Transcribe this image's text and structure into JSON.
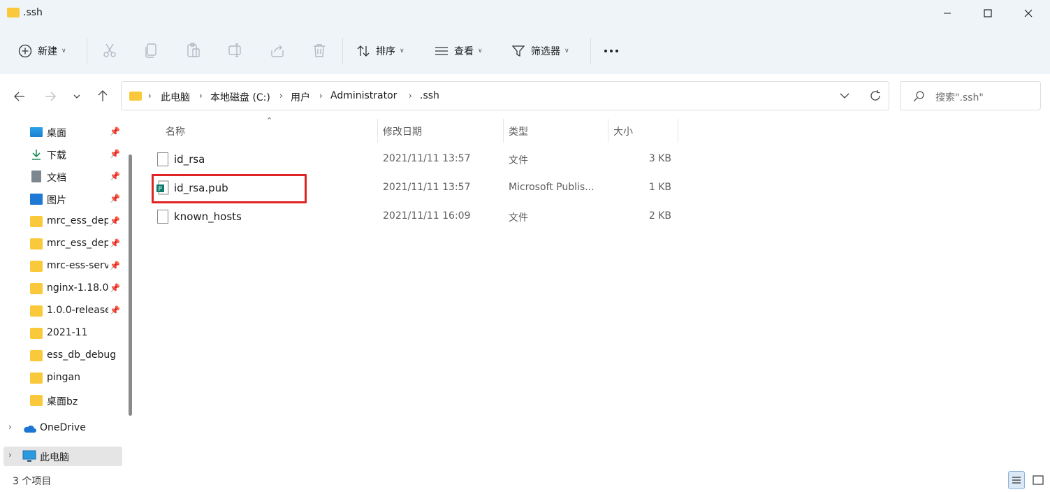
{
  "window": {
    "title": ".ssh",
    "minimize_icon": "minimize-icon",
    "maximize_icon": "maximize-icon",
    "close_icon": "close-icon"
  },
  "toolbar": {
    "new_label": "新建",
    "sort_label": "排序",
    "view_label": "查看",
    "filter_label": "筛选器",
    "icons": [
      "cut-icon",
      "copy-icon",
      "paste-icon",
      "rename-icon",
      "share-icon",
      "delete-icon",
      "more-icon"
    ]
  },
  "address": {
    "crumbs": [
      "此电脑",
      "本地磁盘 (C:)",
      "用户",
      "Administrator",
      ".ssh"
    ]
  },
  "search": {
    "placeholder": "搜索\".ssh\""
  },
  "sidebar": {
    "items": [
      {
        "label": "桌面",
        "icon": "desktop-icon",
        "pinned": true
      },
      {
        "label": "下载",
        "icon": "download-icon",
        "pinned": true
      },
      {
        "label": "文档",
        "icon": "document-icon",
        "pinned": true
      },
      {
        "label": "图片",
        "icon": "picture-icon",
        "pinned": true
      },
      {
        "label": "mrc_ess_dep",
        "icon": "folder-icon",
        "pinned": true
      },
      {
        "label": "mrc_ess_dep",
        "icon": "folder-icon",
        "pinned": true
      },
      {
        "label": "mrc-ess-serv",
        "icon": "folder-icon",
        "pinned": true
      },
      {
        "label": "nginx-1.18.0",
        "icon": "folder-icon",
        "pinned": true
      },
      {
        "label": "1.0.0-release",
        "icon": "folder-icon",
        "pinned": true
      },
      {
        "label": "2021-11",
        "icon": "folder-icon",
        "pinned": false
      },
      {
        "label": "ess_db_debug",
        "icon": "folder-icon",
        "pinned": false
      },
      {
        "label": "pingan",
        "icon": "folder-icon",
        "pinned": false
      },
      {
        "label": "桌面bz",
        "icon": "folder-icon",
        "pinned": false
      }
    ],
    "onedrive": "OneDrive",
    "thispc": "此电脑"
  },
  "columns": {
    "name": "名称",
    "date": "修改日期",
    "type": "类型",
    "size": "大小"
  },
  "files": [
    {
      "name": "id_rsa",
      "date": "2021/11/11 13:57",
      "type": "文件",
      "size": "3 KB"
    },
    {
      "name": "id_rsa.pub",
      "date": "2021/11/11 13:57",
      "type": "Microsoft Publis...",
      "size": "1 KB"
    },
    {
      "name": "known_hosts",
      "date": "2021/11/11 16:09",
      "type": "文件",
      "size": "2 KB"
    }
  ],
  "status": {
    "count": "3 个项目"
  },
  "colors": {
    "chrome_bg": "#eff4f9",
    "highlight_border": "#e02424",
    "folder": "#f9c93b"
  }
}
